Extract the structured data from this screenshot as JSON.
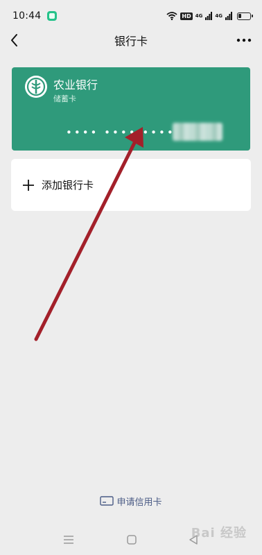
{
  "status_bar": {
    "time": "10:44",
    "hd_label": "HD",
    "signal_label_1": "4G",
    "signal_label_2": "4G"
  },
  "header": {
    "title": "银行卡"
  },
  "bank_card": {
    "bank_name": "农业银行",
    "card_type": "储蓄卡",
    "masked_number": "•••• •••• ••••",
    "background_color": "#2f9a7b"
  },
  "add_card": {
    "label": "添加银行卡"
  },
  "footer": {
    "apply_label": "申请信用卡"
  },
  "watermark": {
    "text": "Bai 经验"
  },
  "icons": {
    "back": "chevron-left-icon",
    "more": "more-dots-icon",
    "add": "plus-icon",
    "card": "credit-card-icon",
    "logo": "abc-bank-logo-icon"
  }
}
